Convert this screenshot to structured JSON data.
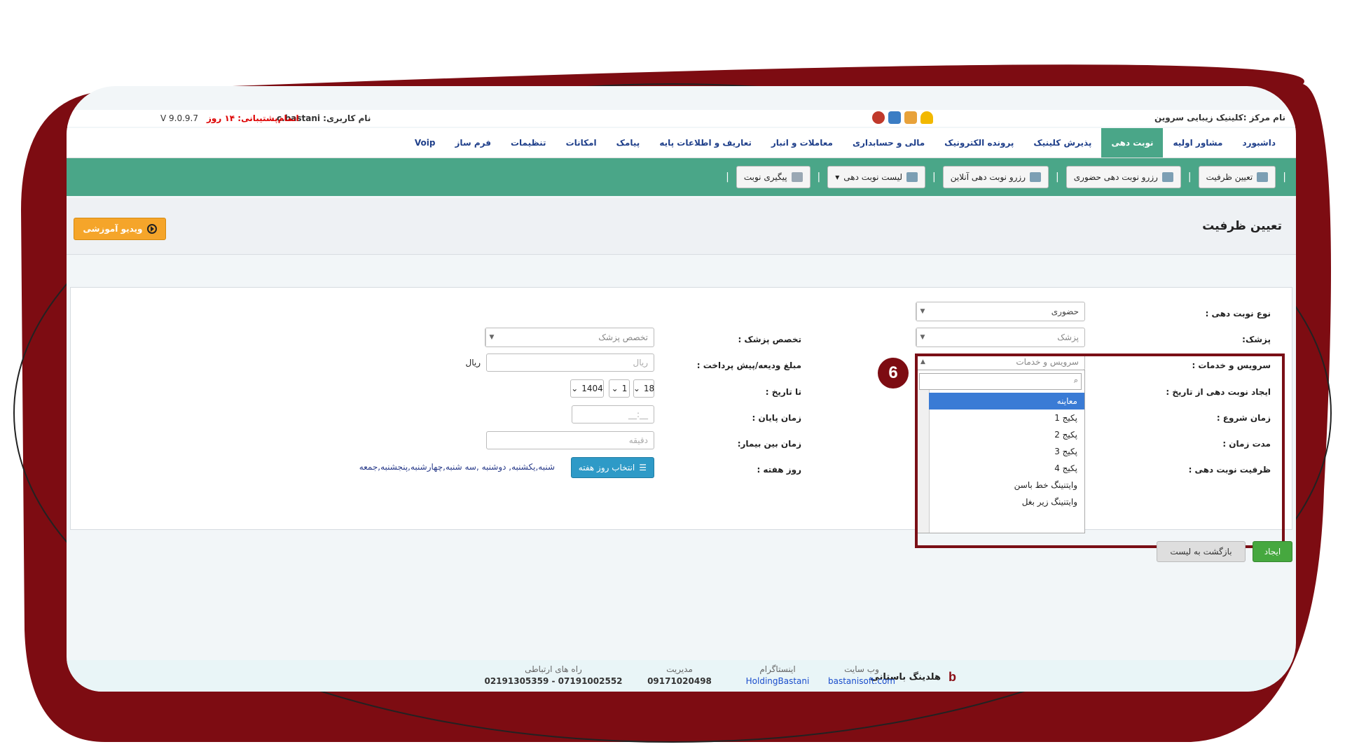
{
  "header": {
    "center_name": "نام مرکز :کلینیک زیبایی سروین",
    "username_label": "نام کاربری: c.bastani",
    "support_label": "اتمام‌پشتیبانی: ۱۴ روز",
    "version": "V 9.0.9.7"
  },
  "nav": {
    "items": [
      "داشبورد",
      "مشاور اولیه",
      "نوبت دهی",
      "پذیرش کلینیک",
      "پرونده الکترونیک",
      "مالی و حسابداری",
      "معاملات و انبار",
      "تعاریف و اطلاعات پایه",
      "پیامک",
      "امکانات",
      "تنظیمات",
      "فرم ساز",
      "Voip"
    ],
    "active": "نوبت دهی"
  },
  "actions": {
    "items": [
      "تعیین ظرفیت",
      "رزرو نوبت دهی حضوری",
      "رزرو نوبت دهی آنلاین",
      "لیست نوبت دهی",
      "پیگیری نوبت"
    ]
  },
  "page": {
    "title": "تعیین ظرفیت",
    "video_button": "ویدیو آموزشی"
  },
  "form": {
    "type_label": "نوع نوبت دهی :",
    "type_value": "حضوری",
    "doctor_label": "پزشک:",
    "doctor_placeholder": "پزشک",
    "specialty_label": "تخصص پزشک :",
    "specialty_placeholder": "تخصص پزشک",
    "service_label": "سرویس و خدمات :",
    "service_placeholder": "سرویس و خدمات",
    "deposit_label": "مبلغ ودیعه/پیش پرداخت :",
    "deposit_placeholder": "ریال",
    "deposit_unit": "ریال",
    "from_date_label": "ایجاد نوبت دهی از تاریخ :",
    "to_date_label": "تا تاریخ :",
    "to_date_day": "18",
    "to_date_month": "1",
    "to_date_year": "1404",
    "start_time_label": "زمان شروع :",
    "end_time_label": "زمان پایان :",
    "end_time_placeholder": "__:__",
    "duration_label": "مدت زمان :",
    "between_label": "زمان بین بیمار:",
    "between_placeholder": "دقیقه",
    "capacity_label": "ظرفیت نوبت دهی :",
    "weekday_label": "روز هفته :",
    "weekday_button": "انتخاب روز هفته",
    "weekday_value": "شنبه,یکشنبه, دوشنبه ,سه شنبه,چهارشنبه,پنجشنبه,جمعه"
  },
  "dropdown": {
    "options": [
      "معاینه",
      "پکیج 1",
      "پکیج 2",
      "پکیج 3",
      "پکیج 4",
      "وایتنینگ خط باسن",
      "وایتنینگ زیر بغل"
    ],
    "selected": "معاینه"
  },
  "annotation": {
    "badge": "6"
  },
  "buttons": {
    "create": "ایجاد",
    "back": "بازگشت به لیست"
  },
  "footer": {
    "brand": "هلدینگ باستانی",
    "website_caption": "وب سایت",
    "website": "bastanisoft.com",
    "instagram_caption": "اینستاگرام",
    "instagram": "HoldingBastani",
    "manager_caption": "مدیریت",
    "manager": "09171020498",
    "contact_caption": "راه های ارتباطی",
    "contact": "07191002552 - 02191305359"
  },
  "colors": {
    "frame": "#7d0c12",
    "nav_active": "#4aa688",
    "action_bar": "#4aa688",
    "highlight": "#7a0f16"
  }
}
